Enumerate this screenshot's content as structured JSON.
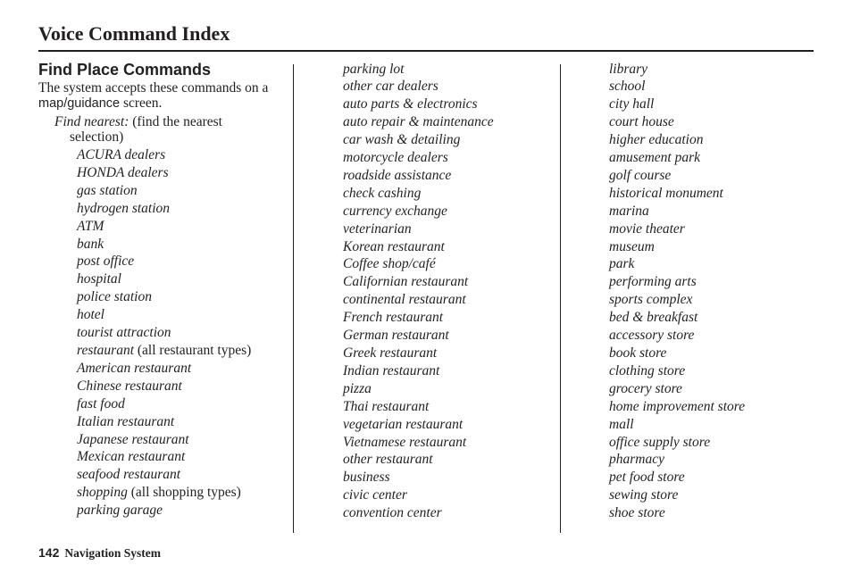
{
  "page": {
    "title": "Voice Command Index",
    "section_heading": "Find Place Commands",
    "intro": {
      "text_before": "The system accepts these commands on a ",
      "screen_name": "map/guidance",
      "text_after": " screen."
    },
    "find_nearest": {
      "command": "Find nearest:",
      "note_line1": " (find the nearest",
      "note_line2": "selection)"
    }
  },
  "columns": {
    "col1": [
      {
        "cmd": "ACURA dealers"
      },
      {
        "cmd": "HONDA dealers"
      },
      {
        "cmd": "gas station"
      },
      {
        "cmd": "hydrogen station"
      },
      {
        "cmd": "ATM"
      },
      {
        "cmd": "bank"
      },
      {
        "cmd": "post office"
      },
      {
        "cmd": "hospital"
      },
      {
        "cmd": "police station"
      },
      {
        "cmd": "hotel"
      },
      {
        "cmd": "tourist attraction"
      },
      {
        "cmd": "restaurant",
        "note": " (all restaurant types)"
      },
      {
        "cmd": "American restaurant"
      },
      {
        "cmd": "Chinese restaurant"
      },
      {
        "cmd": "fast food"
      },
      {
        "cmd": "Italian restaurant"
      },
      {
        "cmd": "Japanese restaurant"
      },
      {
        "cmd": "Mexican restaurant"
      },
      {
        "cmd": "seafood restaurant"
      },
      {
        "cmd": "shopping",
        "note": " (all shopping types)"
      },
      {
        "cmd": "parking garage"
      }
    ],
    "col2": [
      {
        "cmd": "parking lot"
      },
      {
        "cmd": "other car dealers"
      },
      {
        "cmd": "auto parts & electronics"
      },
      {
        "cmd": "auto repair & maintenance"
      },
      {
        "cmd": "car wash & detailing"
      },
      {
        "cmd": "motorcycle dealers"
      },
      {
        "cmd": "roadside assistance"
      },
      {
        "cmd": "check cashing"
      },
      {
        "cmd": "currency exchange"
      },
      {
        "cmd": "veterinarian"
      },
      {
        "cmd": "Korean restaurant"
      },
      {
        "cmd": "Coffee shop/café"
      },
      {
        "cmd": "Californian restaurant"
      },
      {
        "cmd": "continental restaurant"
      },
      {
        "cmd": "French restaurant"
      },
      {
        "cmd": "German restaurant"
      },
      {
        "cmd": "Greek restaurant"
      },
      {
        "cmd": "Indian restaurant"
      },
      {
        "cmd": "pizza"
      },
      {
        "cmd": "Thai restaurant"
      },
      {
        "cmd": "vegetarian restaurant"
      },
      {
        "cmd": "Vietnamese restaurant"
      },
      {
        "cmd": "other restaurant"
      },
      {
        "cmd": "business"
      },
      {
        "cmd": "civic center"
      },
      {
        "cmd": "convention center"
      }
    ],
    "col3": [
      {
        "cmd": "library"
      },
      {
        "cmd": "school"
      },
      {
        "cmd": "city hall"
      },
      {
        "cmd": "court house"
      },
      {
        "cmd": "higher education"
      },
      {
        "cmd": "amusement park"
      },
      {
        "cmd": "golf course"
      },
      {
        "cmd": "historical monument"
      },
      {
        "cmd": "marina"
      },
      {
        "cmd": "movie theater"
      },
      {
        "cmd": "museum"
      },
      {
        "cmd": "park"
      },
      {
        "cmd": "performing arts"
      },
      {
        "cmd": "sports complex"
      },
      {
        "cmd": "bed & breakfast"
      },
      {
        "cmd": "accessory store"
      },
      {
        "cmd": "book store"
      },
      {
        "cmd": "clothing store"
      },
      {
        "cmd": "grocery store"
      },
      {
        "cmd": "home improvement store"
      },
      {
        "cmd": "mall"
      },
      {
        "cmd": "office supply store"
      },
      {
        "cmd": "pharmacy"
      },
      {
        "cmd": "pet food store"
      },
      {
        "cmd": "sewing store"
      },
      {
        "cmd": "shoe store"
      }
    ]
  },
  "footer": {
    "page_number": "142",
    "label": "Navigation System"
  }
}
